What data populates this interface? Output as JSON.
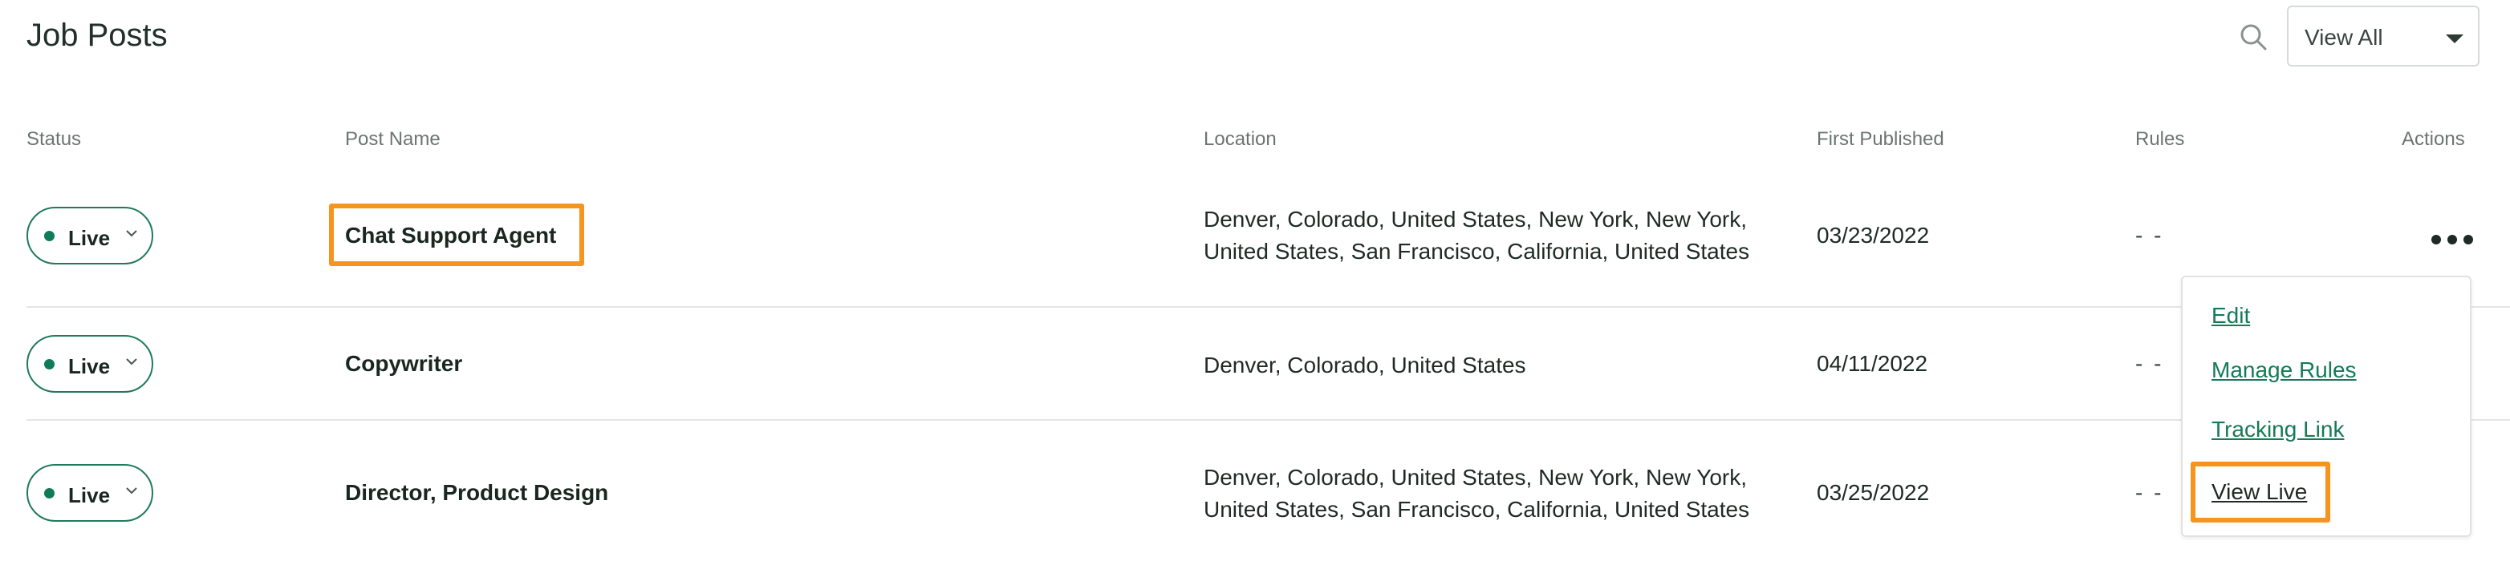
{
  "page": {
    "title": "Job Posts"
  },
  "toolbar": {
    "search_icon": "search-icon",
    "filter": {
      "selected": "View All",
      "caret_icon": "caret-down-icon"
    }
  },
  "table": {
    "columns": [
      "Status",
      "Post Name",
      "Location",
      "First Published",
      "Rules",
      "Actions"
    ],
    "rows": [
      {
        "status": "Live",
        "post_name": "Chat Support Agent",
        "location": "Denver, Colorado, United States, New York, New York, United States, San Francisco, California, United States",
        "first_published": "03/23/2022",
        "rules": "- -"
      },
      {
        "status": "Live",
        "post_name": "Copywriter",
        "location": "Denver, Colorado, United States",
        "first_published": "04/11/2022",
        "rules": "- -"
      },
      {
        "status": "Live",
        "post_name": "Director, Product Design",
        "location": "Denver, Colorado, United States, New York, New York, United States, San Francisco, California, United States",
        "first_published": "03/25/2022",
        "rules": "- -"
      }
    ]
  },
  "actions_menu": {
    "items": [
      "Edit",
      "Manage Rules",
      "Tracking Link",
      "View Live"
    ]
  },
  "colors": {
    "accent_green": "#0f7c57",
    "highlight_orange": "#f7941d",
    "text_dark": "#1f2a24",
    "header_gray": "#6b7570"
  }
}
